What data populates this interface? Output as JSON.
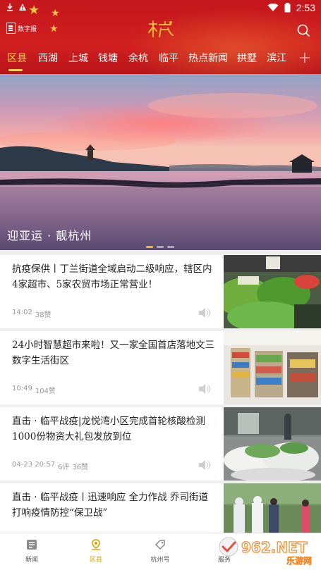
{
  "status_bar": {
    "time": "2:53"
  },
  "header": {
    "digital_paper_label": "数字报",
    "logo_text": "杭",
    "tabs": [
      {
        "label": "区县",
        "active": true
      },
      {
        "label": "西湖",
        "active": false
      },
      {
        "label": "上城",
        "active": false
      },
      {
        "label": "钱塘",
        "active": false
      },
      {
        "label": "余杭",
        "active": false
      },
      {
        "label": "临平",
        "active": false
      },
      {
        "label": "热点新闻",
        "active": false
      },
      {
        "label": "拱墅",
        "active": false
      },
      {
        "label": "滨江",
        "active": false
      }
    ],
    "add_label": "+"
  },
  "hero": {
    "caption": "迎亚运 · 靓杭州",
    "slide_count": 3,
    "active_slide": 1
  },
  "feed": [
    {
      "title": "抗疫保供丨丁兰街道全域启动二级响应，辖区内4家超市、5家农贸市场正常营业！",
      "time": "14:02",
      "likes": "38赞",
      "comments": ""
    },
    {
      "title": "24小时智慧超市来啦！又一家全国首店落地文三数字生活街区",
      "time": "10:49",
      "likes": "104赞",
      "comments": ""
    },
    {
      "title": "直击 · 临平战疫|龙悦湾小区完成首轮核酸检测1000份物资大礼包发放到位",
      "time": "04-23 20:57",
      "likes": "36赞",
      "comments": "6评"
    },
    {
      "title": "直击 · 临平战疫丨迅速响应 全力作战 乔司街道打响疫情防控“保卫战”",
      "time": "",
      "likes": "",
      "comments": ""
    }
  ],
  "bottom_nav": [
    {
      "label": "新闻",
      "icon": "news-icon",
      "active": false
    },
    {
      "label": "区县",
      "icon": "location-icon",
      "active": true
    },
    {
      "label": "杭州号",
      "icon": "tag-icon",
      "active": false
    },
    {
      "label": "服务",
      "icon": "service-icon",
      "active": false
    }
  ],
  "watermark": {
    "brand": "962.NET",
    "sub": "乐游网"
  },
  "colors": {
    "header_red": "#c4161c",
    "accent_gold": "#ffd25a",
    "active_nav": "#d9a100"
  }
}
